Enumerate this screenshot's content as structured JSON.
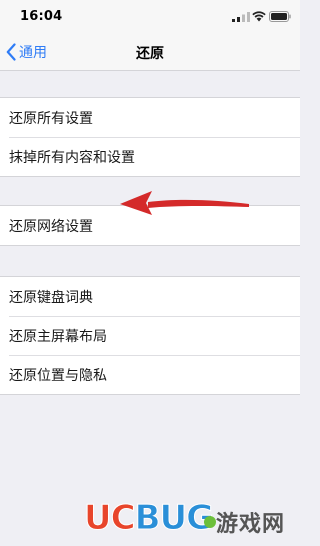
{
  "status_bar": {
    "time": "16:04"
  },
  "nav": {
    "back_label": "通用",
    "title": "还原"
  },
  "groups": [
    {
      "items": [
        {
          "label": "还原所有设置"
        },
        {
          "label": "抹掉所有内容和设置"
        }
      ]
    },
    {
      "items": [
        {
          "label": "还原网络设置"
        }
      ]
    },
    {
      "items": [
        {
          "label": "还原键盘词典"
        },
        {
          "label": "还原主屏幕布局"
        },
        {
          "label": "还原位置与隐私"
        }
      ]
    }
  ],
  "annotation": {
    "type": "red-arrow",
    "color": "#d42a2a",
    "points_to": "还原网络设置"
  },
  "watermark": {
    "brand": "UCBUG",
    "brand_part1": "UC",
    "brand_part2": "BUG",
    "site_name": "游戏网",
    "colors": {
      "uc": "#e8452b",
      "bug": "#2a8fd8"
    }
  },
  "colors": {
    "background": "#efeff4",
    "accent": "#2f7cf6",
    "cell": "#ffffff"
  },
  "icons": {
    "back": "chevron-left-icon",
    "signal": "cellular-signal-icon",
    "wifi": "wifi-icon",
    "battery": "battery-icon"
  }
}
